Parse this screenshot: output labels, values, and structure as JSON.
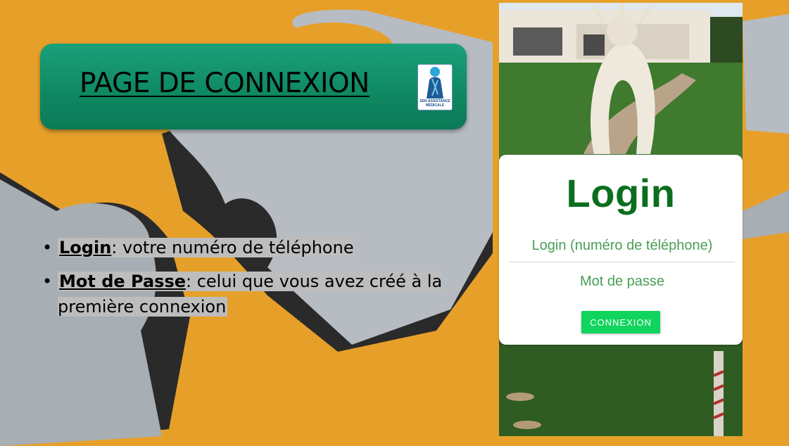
{
  "banner": {
    "title": "PAGE DE CONNEXION",
    "logo_text": "SEN ASSISTANCE MÉDICALE"
  },
  "bullets": [
    {
      "key": "Login",
      "rest": ": votre numéro de téléphone"
    },
    {
      "key": "Mot de Passe",
      "rest": ": celui que vous avez créé à la première connexion"
    }
  ],
  "login_form": {
    "title": "Login",
    "login_placeholder": "Login (numéro de téléphone)",
    "password_placeholder": "Mot de passe",
    "button_label": "CONNEXION"
  },
  "colors": {
    "banner_green": "#0f8a63",
    "button_green": "#10d45e",
    "title_green": "#0b6e1f",
    "background_orange": "#e8a22a"
  }
}
